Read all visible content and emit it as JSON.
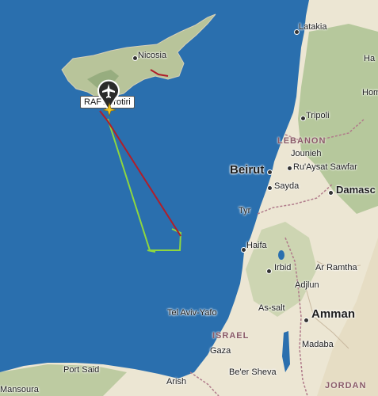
{
  "map": {
    "places": {
      "latakia": "Latakia",
      "nicosia": "Nicosia",
      "tripoli": "Tripoli",
      "lebanon": "LEBANON",
      "jounieh": "Jounieh",
      "beirut": "Beirut",
      "ruaysat": "Ru'Aysat Sawfar",
      "damascus": "Damasc",
      "sayda": "Sayda",
      "tyr": "Tyr",
      "haifa": "Haifa",
      "irbid": "Irbid",
      "ar_ramtha": "Ar Ramtha",
      "adjlun": "Adjlun",
      "as_salt": "As-salt",
      "tel_aviv": "Tel Aviv-Yafo",
      "amman": "Amman",
      "israel": "ISRAEL",
      "gaza": "Gaza",
      "madaba": "Madaba",
      "port_said": "Port Said",
      "beer_sheva": "Be'er Sheva",
      "arish": "Arish",
      "jordan": "JORDAN",
      "mansoura": "Mansoura",
      "h_cut": "Ha",
      "hom_cut": "Hom"
    },
    "aircraft": {
      "callout_label": "RAF Akrotiri",
      "callout_visible": "RAF"
    },
    "track": {
      "colors": {
        "climb": "#b01e2a",
        "cruise": "#8ed63f",
        "marker": "#f3c623"
      }
    },
    "colors": {
      "sea": "#2a6fae",
      "land": "#ece6d3",
      "green_land": "#9bb88a",
      "border": "#b07a8a"
    }
  }
}
